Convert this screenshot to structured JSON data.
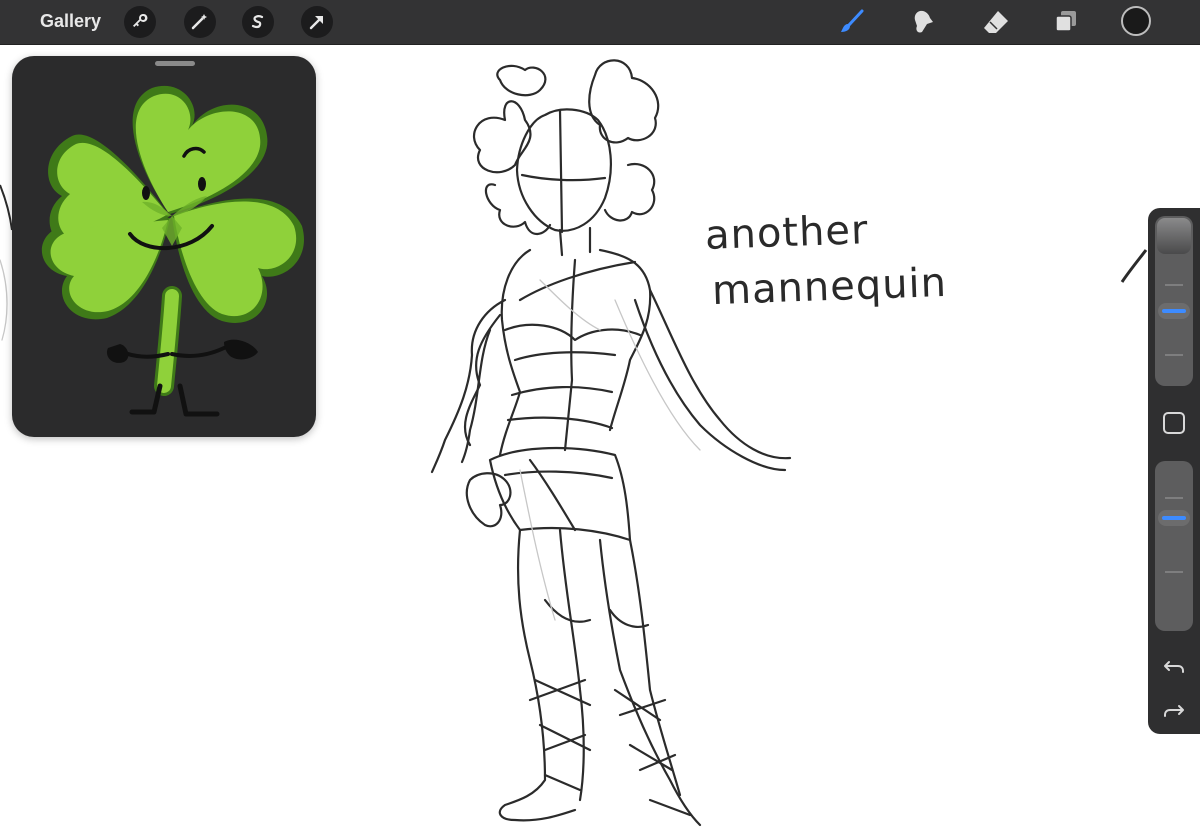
{
  "topbar": {
    "gallery_label": "Gallery",
    "left_tools": [
      "wrench-icon",
      "magic-wand-icon",
      "selection-icon",
      "transform-arrow-icon"
    ],
    "right_tools": [
      "brush-icon",
      "smudge-icon",
      "eraser-icon",
      "layers-icon"
    ],
    "active_tool": "brush-icon",
    "active_color": "#1a1a1a",
    "accent_color": "#3d8bff"
  },
  "reference": {
    "image": "clover-character",
    "colors": {
      "leaf": "#8fd13a",
      "leaf_shade": "#6fb32a",
      "outline": "#3f7a18",
      "background": "#2b2b2c"
    }
  },
  "canvas": {
    "note_line1": "another",
    "note_line2": "mannequin"
  },
  "sidebar": {
    "brush_size_level": 0.5,
    "opacity_level": 0.4,
    "modify_button": "square-icon",
    "undo": "undo-icon",
    "redo": "redo-icon"
  }
}
